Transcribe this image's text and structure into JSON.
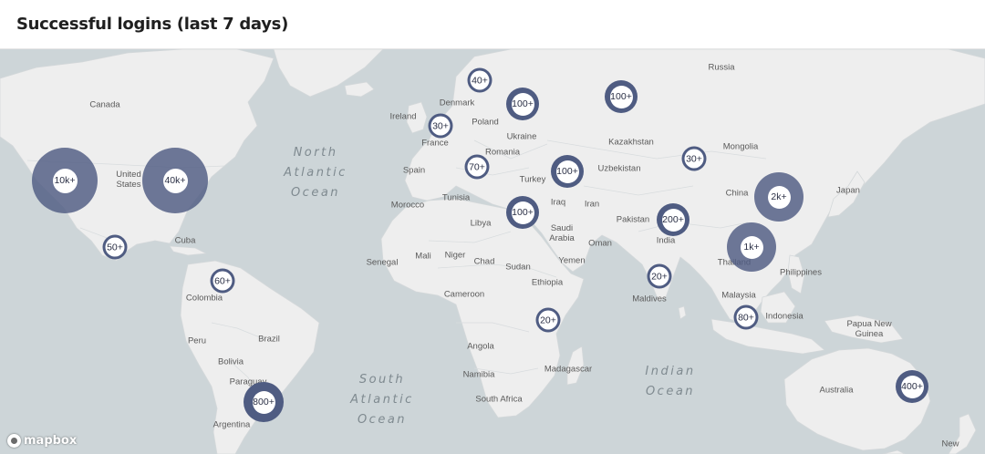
{
  "header": {
    "title": "Successful logins (last 7 days)"
  },
  "colors": {
    "water": "#cdd5d8",
    "land": "#eeeeee",
    "cluster_ring": "#4f5c82",
    "cluster_text": "#2a2f45"
  },
  "map": {
    "countries": [
      {
        "id": "russia",
        "name": "Russia"
      },
      {
        "id": "canada",
        "name": "Canada"
      },
      {
        "id": "united-states",
        "name": "United\nStates"
      },
      {
        "id": "cuba",
        "name": "Cuba"
      },
      {
        "id": "colombia",
        "name": "Colombia"
      },
      {
        "id": "peru",
        "name": "Peru"
      },
      {
        "id": "brazil",
        "name": "Brazil"
      },
      {
        "id": "bolivia",
        "name": "Bolivia"
      },
      {
        "id": "paraguay",
        "name": "Paraguay"
      },
      {
        "id": "argentina",
        "name": "Argentina"
      },
      {
        "id": "ireland",
        "name": "Ireland"
      },
      {
        "id": "denmark",
        "name": "Denmark"
      },
      {
        "id": "poland",
        "name": "Poland"
      },
      {
        "id": "france",
        "name": "France"
      },
      {
        "id": "ukraine",
        "name": "Ukraine"
      },
      {
        "id": "romania",
        "name": "Romania"
      },
      {
        "id": "spain",
        "name": "Spain"
      },
      {
        "id": "turkey",
        "name": "Turkey"
      },
      {
        "id": "kazakhstan",
        "name": "Kazakhstan"
      },
      {
        "id": "uzbekistan",
        "name": "Uzbekistan"
      },
      {
        "id": "mongolia",
        "name": "Mongolia"
      },
      {
        "id": "china",
        "name": "China"
      },
      {
        "id": "japan",
        "name": "Japan"
      },
      {
        "id": "morocco",
        "name": "Morocco"
      },
      {
        "id": "tunisia",
        "name": "Tunisia"
      },
      {
        "id": "libya",
        "name": "Libya"
      },
      {
        "id": "iraq",
        "name": "Iraq"
      },
      {
        "id": "iran",
        "name": "Iran"
      },
      {
        "id": "pakistan",
        "name": "Pakistan"
      },
      {
        "id": "saudi-arabia",
        "name": "Saudi\nArabia"
      },
      {
        "id": "oman",
        "name": "Oman"
      },
      {
        "id": "india",
        "name": "India"
      },
      {
        "id": "thailand",
        "name": "Thailand"
      },
      {
        "id": "philippines",
        "name": "Philippines"
      },
      {
        "id": "senegal",
        "name": "Senegal"
      },
      {
        "id": "mali",
        "name": "Mali"
      },
      {
        "id": "niger",
        "name": "Niger"
      },
      {
        "id": "chad",
        "name": "Chad"
      },
      {
        "id": "sudan",
        "name": "Sudan"
      },
      {
        "id": "yemen",
        "name": "Yemen"
      },
      {
        "id": "ethiopia",
        "name": "Ethiopia"
      },
      {
        "id": "cameroon",
        "name": "Cameroon"
      },
      {
        "id": "maldives",
        "name": "Maldives"
      },
      {
        "id": "malaysia",
        "name": "Malaysia"
      },
      {
        "id": "indonesia",
        "name": "Indonesia"
      },
      {
        "id": "papua-new-guinea",
        "name": "Papua New\nGuinea"
      },
      {
        "id": "angola",
        "name": "Angola"
      },
      {
        "id": "namibia",
        "name": "Namibia"
      },
      {
        "id": "madagascar",
        "name": "Madagascar"
      },
      {
        "id": "south-africa",
        "name": "South Africa"
      },
      {
        "id": "australia",
        "name": "Australia"
      },
      {
        "id": "new-zealand",
        "name": "New"
      }
    ],
    "oceans": [
      {
        "id": "north-atlantic",
        "name": "North\nAtlantic\nOcean"
      },
      {
        "id": "south-atlantic",
        "name": "South\nAtlantic\nOcean"
      },
      {
        "id": "indian",
        "name": "Indian\nOcean"
      }
    ],
    "attribution": "mapbox"
  },
  "clusters": [
    {
      "id": "us-west",
      "label": "10k+",
      "size": "xl"
    },
    {
      "id": "us-east",
      "label": "40k+",
      "size": "xl"
    },
    {
      "id": "mexico",
      "label": "50+",
      "size": "sm"
    },
    {
      "id": "colombia",
      "label": "60+",
      "size": "sm"
    },
    {
      "id": "brazil-south",
      "label": "800+",
      "size": "md"
    },
    {
      "id": "baltic",
      "label": "40+",
      "size": "sm"
    },
    {
      "id": "poland",
      "label": "100+",
      "size": "md"
    },
    {
      "id": "russia-west",
      "label": "100+",
      "size": "md"
    },
    {
      "id": "uk-france",
      "label": "30+",
      "size": "sm"
    },
    {
      "id": "balkans",
      "label": "70+",
      "size": "sm"
    },
    {
      "id": "turkey",
      "label": "100+",
      "size": "md"
    },
    {
      "id": "egypt",
      "label": "100+",
      "size": "md"
    },
    {
      "id": "kazakhstan-east",
      "label": "30+",
      "size": "sm"
    },
    {
      "id": "india-north",
      "label": "200+",
      "size": "md"
    },
    {
      "id": "india-south",
      "label": "20+",
      "size": "sm"
    },
    {
      "id": "east-africa",
      "label": "20+",
      "size": "sm"
    },
    {
      "id": "china-east",
      "label": "2k+",
      "size": "lg"
    },
    {
      "id": "southeast-asia",
      "label": "1k+",
      "size": "lg"
    },
    {
      "id": "indonesia",
      "label": "80+",
      "size": "sm"
    },
    {
      "id": "australia-east",
      "label": "400+",
      "size": "md"
    }
  ]
}
